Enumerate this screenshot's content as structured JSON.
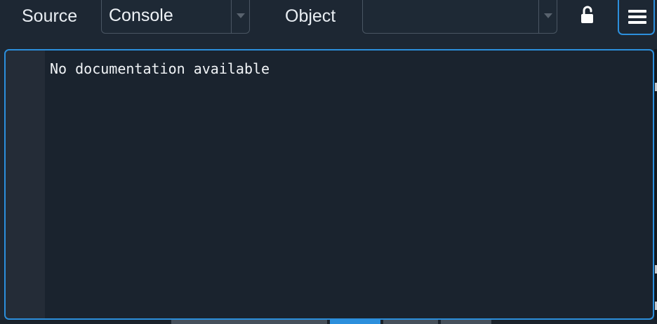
{
  "toolbar": {
    "source_label": "Source",
    "source_value": "Console",
    "object_label": "Object",
    "object_value": "",
    "lock_icon": "unlocked-padlock-icon",
    "menu_icon": "hamburger-menu-icon",
    "accent_color": "#2c8fdc"
  },
  "doc": {
    "text": "No documentation available"
  }
}
